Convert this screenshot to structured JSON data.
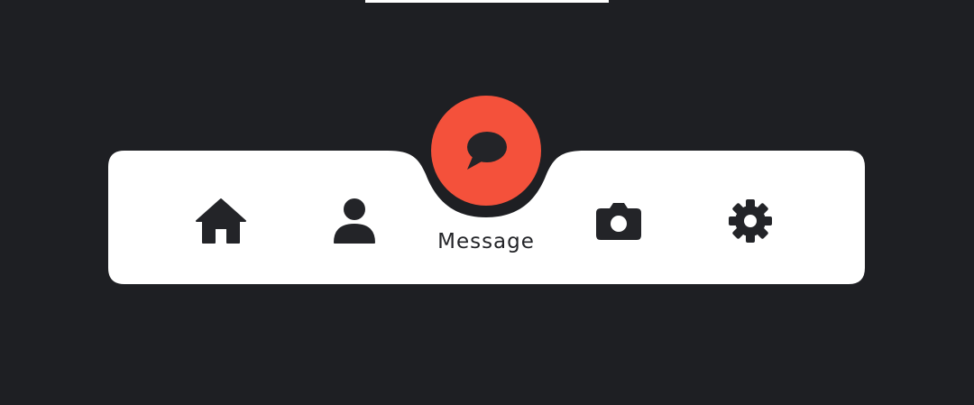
{
  "bottom_nav": {
    "active_label": "Message",
    "items": [
      {
        "id": "home",
        "icon": "home-icon"
      },
      {
        "id": "profile",
        "icon": "user-icon"
      },
      {
        "id": "message",
        "icon": "chat-bubble-icon",
        "label": "Message",
        "active": true
      },
      {
        "id": "camera",
        "icon": "camera-icon"
      },
      {
        "id": "settings",
        "icon": "gear-icon"
      }
    ]
  },
  "colors": {
    "background": "#1e1f23",
    "bar": "#ffffff",
    "accent": "#f4513b",
    "icon": "#232428"
  }
}
